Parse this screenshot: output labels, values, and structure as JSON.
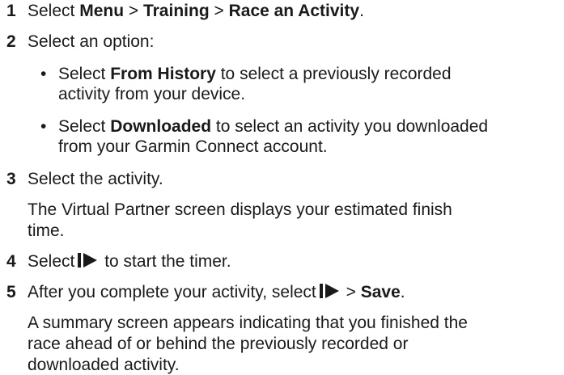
{
  "steps": [
    {
      "number": "1",
      "parts": {
        "a": "Select ",
        "b": "Menu",
        "c": " > ",
        "d": "Training",
        "e": " > ",
        "f": "Race an Activity",
        "g": "."
      }
    },
    {
      "number": "2",
      "text": "Select an option:",
      "options": [
        {
          "pre": "Select ",
          "bold": "From History",
          "line1": " to select a previously recorded",
          "line2": "activity from your device."
        },
        {
          "pre": "Select ",
          "bold": "Downloaded",
          "line1": " to select an activity you downloaded",
          "line2": "from your Garmin Connect account."
        }
      ]
    },
    {
      "number": "3",
      "text": "Select the activity.",
      "note_line1": "The Virtual Partner screen displays your estimated finish",
      "note_line2": "time."
    },
    {
      "number": "4",
      "pre": "Select",
      "icon": "play-pause-icon",
      "post": " to start the timer."
    },
    {
      "number": "5",
      "pre": "After you complete your activity, select",
      "icon": "play-pause-icon",
      "mid": " > ",
      "bold": "Save",
      "end": ".",
      "note_line1": "A summary screen appears indicating that you finished the",
      "note_line2": "race ahead of or behind the previously recorded or",
      "note_line3": "downloaded activity."
    }
  ],
  "bullet_char": "•"
}
